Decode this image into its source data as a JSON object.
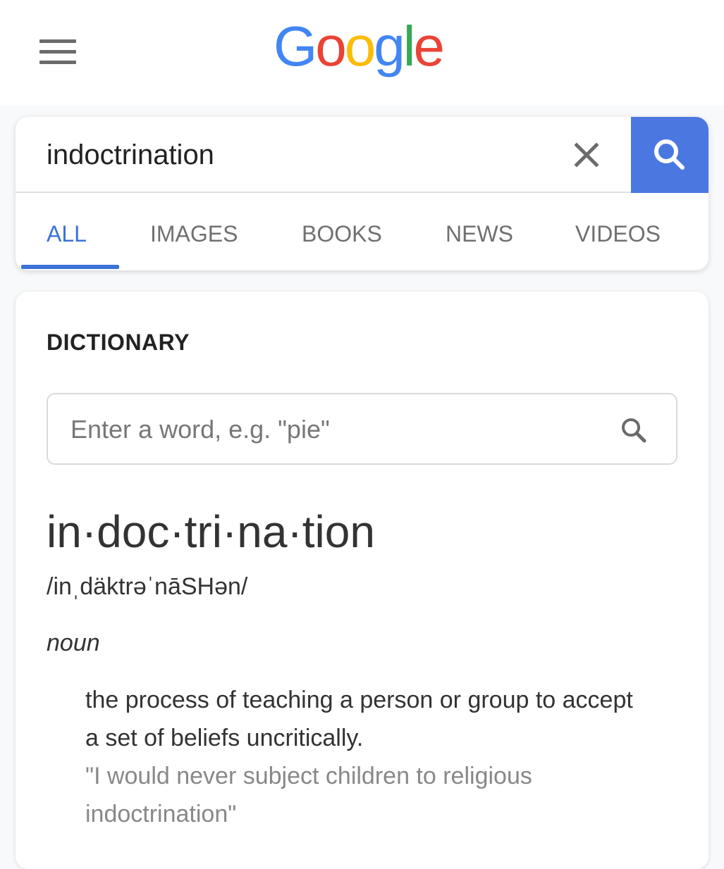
{
  "header": {
    "menu_icon": "hamburger-menu-icon",
    "logo_letters": [
      {
        "char": "G",
        "color": "#4285f4"
      },
      {
        "char": "o",
        "color": "#ea4335"
      },
      {
        "char": "o",
        "color": "#fbbc05"
      },
      {
        "char": "g",
        "color": "#4285f4"
      },
      {
        "char": "l",
        "color": "#34a853"
      },
      {
        "char": "e",
        "color": "#ea4335"
      }
    ]
  },
  "search": {
    "query": "indoctrination",
    "clear_icon": "close-icon",
    "search_icon": "search-icon",
    "button_color": "#4a78e0"
  },
  "tabs": [
    {
      "label": "ALL",
      "active": true
    },
    {
      "label": "IMAGES",
      "active": false
    },
    {
      "label": "BOOKS",
      "active": false
    },
    {
      "label": "NEWS",
      "active": false
    },
    {
      "label": "VIDEOS",
      "active": false
    }
  ],
  "dictionary": {
    "title": "DICTIONARY",
    "input_placeholder": "Enter a word, e.g. \"pie\"",
    "input_value": "",
    "headword": "in·doc·tri·na·tion",
    "phonetic": "/inˌdäktrəˈnāSHən/",
    "part_of_speech": "noun",
    "definition": "the process of teaching a person or group to accept a set of beliefs uncritically.",
    "example": "\"I would never subject children to religious indoctrination\""
  }
}
